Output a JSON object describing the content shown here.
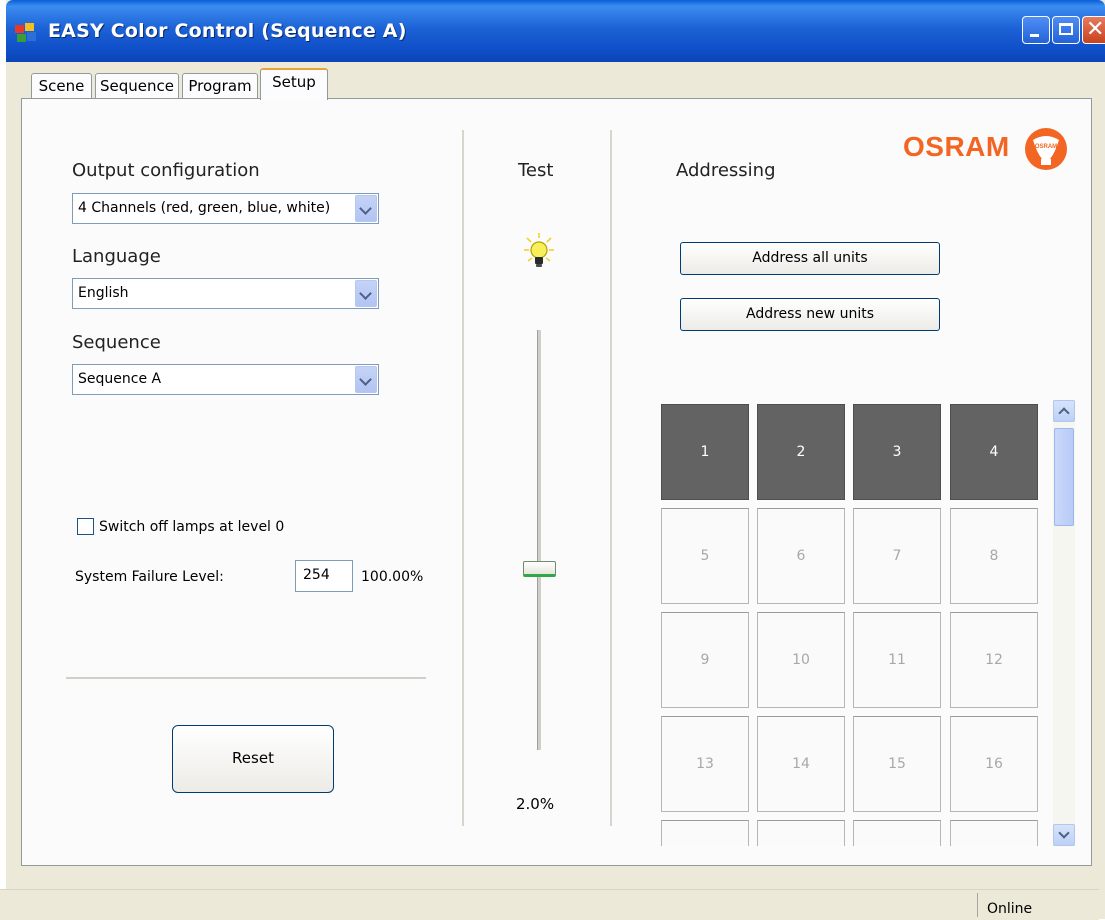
{
  "window": {
    "title": "EASY Color Control (Sequence A)"
  },
  "tabs": [
    {
      "label": "Scene"
    },
    {
      "label": "Sequence"
    },
    {
      "label": "Program"
    },
    {
      "label": "Setup"
    }
  ],
  "setup": {
    "output_configuration": {
      "label": "Output configuration",
      "value": "4 Channels (red, green, blue, white)"
    },
    "language": {
      "label": "Language",
      "value": "English"
    },
    "sequence": {
      "label": "Sequence",
      "value": "Sequence A"
    },
    "switch_off_checkbox": {
      "label": "Switch off lamps at level 0",
      "checked": false
    },
    "system_failure": {
      "label": "System Failure Level:",
      "value": "254",
      "percent": "100.00%"
    },
    "reset_label": "Reset"
  },
  "test": {
    "label": "Test",
    "level_text": "2.0%"
  },
  "addressing": {
    "label": "Addressing",
    "address_all_label": "Address all units",
    "address_new_label": "Address new units",
    "units": [
      {
        "n": "1",
        "active": true
      },
      {
        "n": "2",
        "active": true
      },
      {
        "n": "3",
        "active": true
      },
      {
        "n": "4",
        "active": true
      },
      {
        "n": "5",
        "active": false
      },
      {
        "n": "6",
        "active": false
      },
      {
        "n": "7",
        "active": false
      },
      {
        "n": "8",
        "active": false
      },
      {
        "n": "9",
        "active": false
      },
      {
        "n": "10",
        "active": false
      },
      {
        "n": "11",
        "active": false
      },
      {
        "n": "12",
        "active": false
      },
      {
        "n": "13",
        "active": false
      },
      {
        "n": "14",
        "active": false
      },
      {
        "n": "15",
        "active": false
      },
      {
        "n": "16",
        "active": false
      },
      {
        "n": "",
        "active": false
      },
      {
        "n": "",
        "active": false
      },
      {
        "n": "",
        "active": false
      },
      {
        "n": "",
        "active": false
      }
    ]
  },
  "brand": {
    "name": "OSRAM",
    "color": "#f26522"
  },
  "status": {
    "text": "Online"
  }
}
